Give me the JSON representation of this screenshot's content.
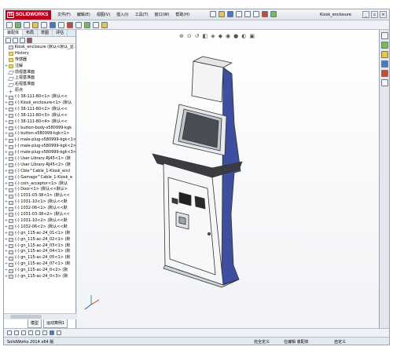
{
  "app": {
    "logo_text": "SOLIDWORKS",
    "document_title": "Kiosk_enclosure",
    "menu": [
      "文件(F)",
      "编辑(E)",
      "视图(V)",
      "插入(I)",
      "工具(T)",
      "窗口(W)",
      "帮助(H)"
    ]
  },
  "panel": {
    "tabs": [
      "装配体",
      "布局",
      "草图",
      "评估"
    ],
    "active_tab": "装配体"
  },
  "tree": [
    {
      "label": "Kiosk_enclosure (默认<默认_显..",
      "exp": "",
      "icon": "part"
    },
    {
      "label": "History",
      "exp": "",
      "icon": "folder"
    },
    {
      "label": "传感器",
      "exp": "",
      "icon": "folder"
    },
    {
      "label": "注解",
      "exp": "+",
      "icon": "folder"
    },
    {
      "label": "前视基准面",
      "exp": "",
      "icon": "plane"
    },
    {
      "label": "上视基准面",
      "exp": "",
      "icon": "plane"
    },
    {
      "label": "右视基准面",
      "exp": "",
      "icon": "plane"
    },
    {
      "label": "原点",
      "exp": "",
      "icon": "origin"
    },
    {
      "label": "(-) 38-111-80<1> (默认<<",
      "exp": "+",
      "icon": "part"
    },
    {
      "label": "(-) Kiosk_enclosure<1> (默认",
      "exp": "+",
      "icon": "part"
    },
    {
      "label": "(-) 38-111-80<2> (默认<<",
      "exp": "+",
      "icon": "part"
    },
    {
      "label": "(-) 38-111-80<3> (默认<<",
      "exp": "+",
      "icon": "part"
    },
    {
      "label": "(-) 38-111-80<4> (默认<<",
      "exp": "+",
      "icon": "part"
    },
    {
      "label": "(-) button-body-s580999-kgk",
      "exp": "+",
      "icon": "part"
    },
    {
      "label": "(-) button-s580999-kgk<1>",
      "exp": "+",
      "icon": "part"
    },
    {
      "label": "(-) male-plug-s580999-kgk<1>",
      "exp": "+",
      "icon": "part"
    },
    {
      "label": "(-) male-plug-s580999-kgk<2>",
      "exp": "+",
      "icon": "part"
    },
    {
      "label": "(-) male-plug-s580999-kgk<3>",
      "exp": "+",
      "icon": "part"
    },
    {
      "label": "(-) User Library-RJ45<1> (默",
      "exp": "+",
      "icon": "part"
    },
    {
      "label": "(-) User Library-RJ45<2> (默",
      "exp": "+",
      "icon": "part"
    },
    {
      "label": "(-) Cble^Cable_1-Kiosk_encl",
      "exp": "+",
      "icon": "part"
    },
    {
      "label": "(-) Gamage^Cable_1-Kiosk_e",
      "exp": "+",
      "icon": "part"
    },
    {
      "label": "(-) coin_acceptor<1> (默认",
      "exp": "+",
      "icon": "part"
    },
    {
      "label": "(-) Door<1> (默认<<默认>",
      "exp": "+",
      "icon": "part"
    },
    {
      "label": "(-) 1031-03-38<1> (默认<<",
      "exp": "+",
      "icon": "part"
    },
    {
      "label": "(-) 1031-10<1> (默认<<默",
      "exp": "+",
      "icon": "part"
    },
    {
      "label": "(-) 1032-06<1> (默认<<默",
      "exp": "+",
      "icon": "part"
    },
    {
      "label": "(-) 1031-03-38<2> (默认<<",
      "exp": "+",
      "icon": "part"
    },
    {
      "label": "(-) 1031-10<2> (默认<<默",
      "exp": "+",
      "icon": "part"
    },
    {
      "label": "(-) 1032-06<2> (默认<<默",
      "exp": "+",
      "icon": "part"
    },
    {
      "label": "(-) gn_115-ac-24_01<1> (默",
      "exp": "+",
      "icon": "part"
    },
    {
      "label": "(-) gn_115-ac-24_02<1> (默",
      "exp": "+",
      "icon": "part"
    },
    {
      "label": "(-) gn_115-ac-24_03<1> (默",
      "exp": "+",
      "icon": "part"
    },
    {
      "label": "(-) gn_115-ac-24_04<1> (默",
      "exp": "+",
      "icon": "part"
    },
    {
      "label": "(-) gn_115-ac-24_05<1> (默",
      "exp": "+",
      "icon": "part"
    },
    {
      "label": "(-) gn_115-ac-24_07<1> (默",
      "exp": "+",
      "icon": "part"
    },
    {
      "label": "(-) gn_115-ac-24_0<2> (默",
      "exp": "+",
      "icon": "part"
    },
    {
      "label": "(-) gn_115-ac-24_0<3> (默",
      "exp": "+",
      "icon": "part"
    }
  ],
  "model_tabs": [
    "模型",
    "运动算例1"
  ],
  "status": {
    "version": "SolidWorks 2014 x64 版",
    "under_defined": "完全定义",
    "editing": "在编辑 装配体",
    "custom": "自定义"
  },
  "colors": {
    "accent_red": "#b8001c",
    "kiosk_blue": "#3d4f9e"
  }
}
